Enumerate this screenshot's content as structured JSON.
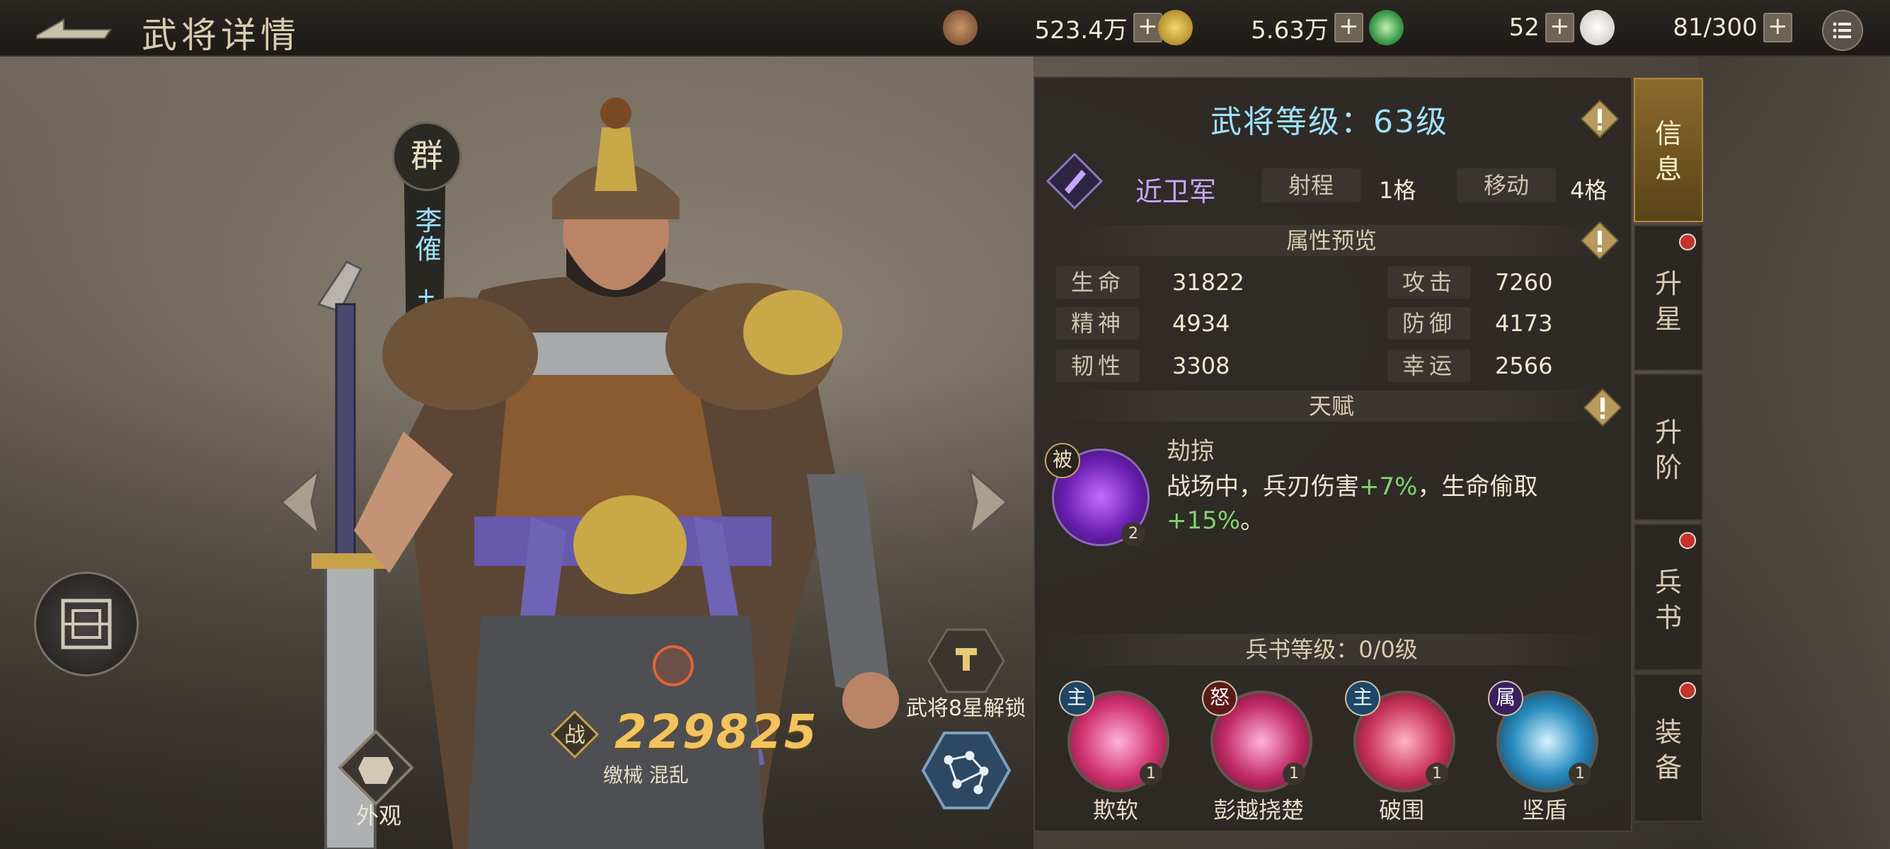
{
  "header": {
    "title": "武将详情",
    "resources": [
      {
        "icon": "copper-coin-stack-icon",
        "value": "523.4万"
      },
      {
        "icon": "gold-coin-icon",
        "value": "5.63万"
      },
      {
        "icon": "jade-disc-icon",
        "value": "52"
      },
      {
        "icon": "steamed-bun-icon",
        "value": "81/300"
      }
    ],
    "plus_label": "+"
  },
  "hero": {
    "faction": "群",
    "name": "李傕",
    "plus": "+ 11",
    "power": "229825",
    "power_icon_label": "战",
    "power_sub": "缴械 混乱",
    "appearance_label": "外观",
    "unlock_label": "武将8星解锁"
  },
  "info": {
    "level_title": "武将等级：63级",
    "troop_type": "近卫军",
    "range_label": "射程",
    "range_value": "1格",
    "move_label": "移动",
    "move_value": "4格",
    "attr_section": "属性预览",
    "stats": [
      {
        "label": "生命",
        "value": "31822"
      },
      {
        "label": "攻击",
        "value": "7260"
      },
      {
        "label": "精神",
        "value": "4934"
      },
      {
        "label": "防御",
        "value": "4173"
      },
      {
        "label": "韧性",
        "value": "3308"
      },
      {
        "label": "幸运",
        "value": "2566"
      }
    ],
    "talent_section": "天赋",
    "talent": {
      "badge": "被",
      "name": "劫掠",
      "level": "2",
      "desc_1": "战场中，兵刃伤害",
      "desc_val_1": "+7%",
      "desc_2": "，生命偷取",
      "desc_val_2": "+15%",
      "desc_3": "。"
    },
    "book_section": "兵书等级：0/0级",
    "skills": [
      {
        "tag": "主",
        "name": "欺软",
        "level": "1"
      },
      {
        "tag": "怒",
        "name": "彭越挠楚",
        "level": "1"
      },
      {
        "tag": "主",
        "name": "破围",
        "level": "1"
      },
      {
        "tag": "属",
        "name": "坚盾",
        "level": "1"
      }
    ]
  },
  "tabs": [
    {
      "label_1": "信",
      "label_2": "息"
    },
    {
      "label_1": "升",
      "label_2": "星"
    },
    {
      "label_1": "升",
      "label_2": "阶"
    },
    {
      "label_1": "兵",
      "label_2": "书"
    },
    {
      "label_1": "装",
      "label_2": "备"
    }
  ],
  "colors": {
    "accent_cyan": "#9fe1ff",
    "power_gold": "#f2c35e",
    "bonus_green": "#7fd66a",
    "troop_purple": "#c9a7ff"
  }
}
